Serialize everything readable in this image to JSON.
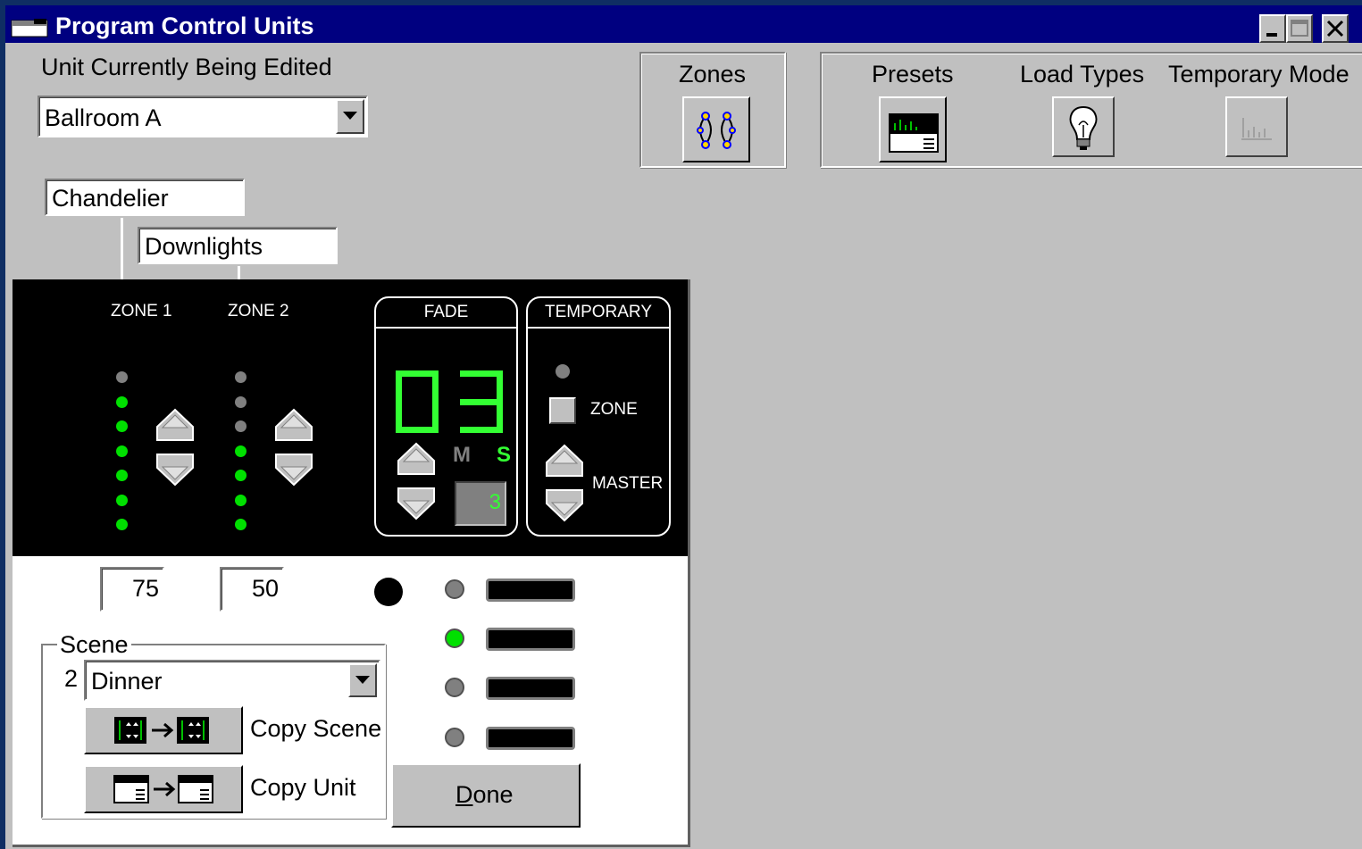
{
  "window": {
    "title": "Program Control Units"
  },
  "unit_label": "Unit Currently Being Edited",
  "unit_select": {
    "value": "Ballroom A"
  },
  "toolbar": {
    "zones_label": "Zones",
    "presets_label": "Presets",
    "load_types_label": "Load Types",
    "temporary_mode_label": "Temporary Mode"
  },
  "zone_names": [
    "Chandelier",
    "Downlights"
  ],
  "zones": [
    {
      "label": "ZONE 1",
      "value": "75",
      "lit_leds": 6
    },
    {
      "label": "ZONE 2",
      "value": "50",
      "lit_leds": 4
    }
  ],
  "fade": {
    "label": "FADE",
    "digits": "03",
    "min_label": "M",
    "sec_label": "S",
    "unit_value": "3"
  },
  "temporary": {
    "label": "TEMPORARY",
    "zone_label": "ZONE",
    "master_label": "MASTER"
  },
  "scene": {
    "group_label": "Scene",
    "number": "2",
    "name": "Dinner",
    "copy_scene_label": "Copy Scene",
    "copy_unit_label": "Copy Unit"
  },
  "scene_indicators": [
    {
      "active": false
    },
    {
      "active": true
    },
    {
      "active": false
    },
    {
      "active": false
    }
  ],
  "done_label": "Done",
  "colors": {
    "title_bar": "#000080",
    "desktop": "#0f2e63",
    "face": "#c0c0c0",
    "led_green": "#00e000",
    "led_off": "#808080"
  }
}
